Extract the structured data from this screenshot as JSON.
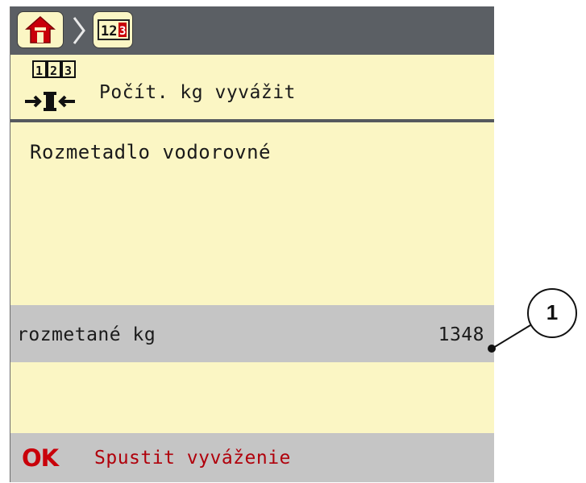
{
  "topbar": {
    "home_icon": "home-icon",
    "breadcrumb_separator": "chevron-right-icon",
    "counter_icon": "counter-icon"
  },
  "header": {
    "title": "Počít. kg vyvážit",
    "icon": "counter-balance-icon"
  },
  "main": {
    "message": "Rozmetadlo vodorovné",
    "value_row": {
      "label": "rozmetané kg",
      "value": "1348"
    }
  },
  "footer": {
    "ok_badge": "OK",
    "action_label": "Spustit vyváženie"
  },
  "callout": {
    "number": "1"
  },
  "colors": {
    "screen_background": "#fbf6c4",
    "topbar": "#5b5f64",
    "row_highlight": "#c5c5c5",
    "ok_red": "#c9000a"
  }
}
